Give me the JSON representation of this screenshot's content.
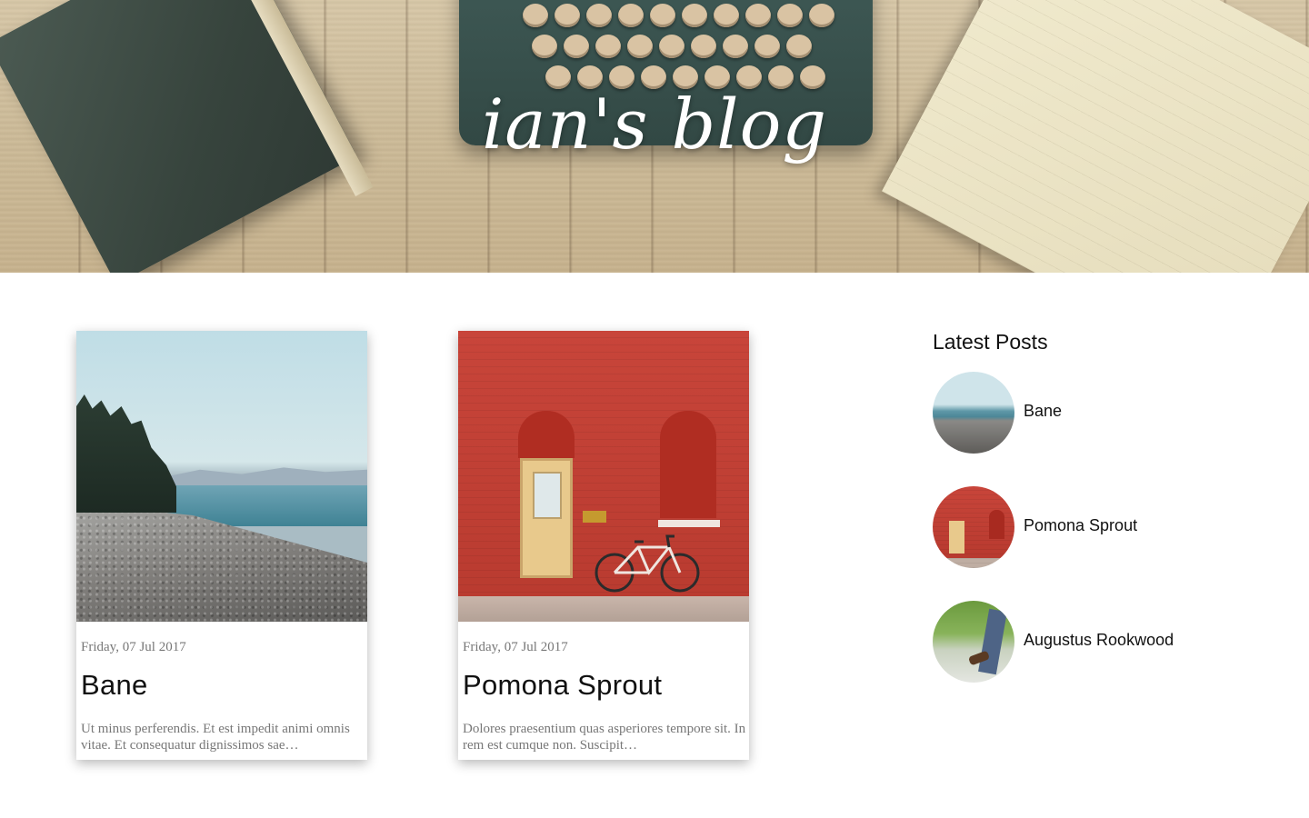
{
  "site": {
    "title": "ian's blog"
  },
  "posts": [
    {
      "date": "Friday, 07 Jul 2017",
      "title": "Bane",
      "excerpt": "Ut minus perferendis. Et est impedit animi omnis vitae. Et consequatur dignissimos sae…",
      "image": "beach-photo"
    },
    {
      "date": "Friday, 07 Jul 2017",
      "title": "Pomona Sprout",
      "excerpt": "Dolores praesentium quas asperiores tempore sit. In rem est cumque non. Suscipit…",
      "image": "red-wall-photo"
    }
  ],
  "sidebar": {
    "title": "Latest Posts",
    "items": [
      {
        "label": "Bane",
        "image": "beach-thumbnail"
      },
      {
        "label": "Pomona Sprout",
        "image": "red-wall-thumbnail"
      },
      {
        "label": "Augustus Rookwood",
        "image": "walking-thumbnail"
      }
    ]
  }
}
